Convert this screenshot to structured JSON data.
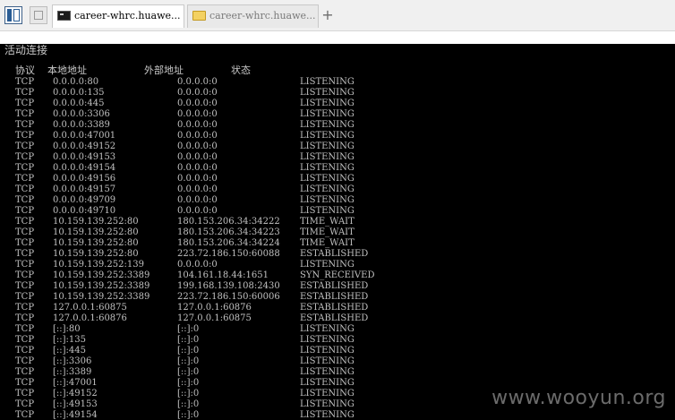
{
  "tabs": [
    {
      "label": "career-whrc.huawe...",
      "icon": "console-icon",
      "active": true
    },
    {
      "label": "career-whrc.huawe...",
      "icon": "folder-icon",
      "active": false
    }
  ],
  "toolbar": {
    "panel_icon": "panel-toggle-icon",
    "new_tab_icon": "blank-page-icon",
    "add_tab_label": "+"
  },
  "console": {
    "section_title": "活动连接",
    "headers": {
      "proto": "协议",
      "local": "本地地址",
      "foreign": "外部地址",
      "state": "状态"
    },
    "rows": [
      {
        "proto": "TCP",
        "local": "0.0.0.0:80",
        "foreign": "0.0.0.0:0",
        "state": "LISTENING"
      },
      {
        "proto": "TCP",
        "local": "0.0.0.0:135",
        "foreign": "0.0.0.0:0",
        "state": "LISTENING"
      },
      {
        "proto": "TCP",
        "local": "0.0.0.0:445",
        "foreign": "0.0.0.0:0",
        "state": "LISTENING"
      },
      {
        "proto": "TCP",
        "local": "0.0.0.0:3306",
        "foreign": "0.0.0.0:0",
        "state": "LISTENING"
      },
      {
        "proto": "TCP",
        "local": "0.0.0.0:3389",
        "foreign": "0.0.0.0:0",
        "state": "LISTENING"
      },
      {
        "proto": "TCP",
        "local": "0.0.0.0:47001",
        "foreign": "0.0.0.0:0",
        "state": "LISTENING"
      },
      {
        "proto": "TCP",
        "local": "0.0.0.0:49152",
        "foreign": "0.0.0.0:0",
        "state": "LISTENING"
      },
      {
        "proto": "TCP",
        "local": "0.0.0.0:49153",
        "foreign": "0.0.0.0:0",
        "state": "LISTENING"
      },
      {
        "proto": "TCP",
        "local": "0.0.0.0:49154",
        "foreign": "0.0.0.0:0",
        "state": "LISTENING"
      },
      {
        "proto": "TCP",
        "local": "0.0.0.0:49156",
        "foreign": "0.0.0.0:0",
        "state": "LISTENING"
      },
      {
        "proto": "TCP",
        "local": "0.0.0.0:49157",
        "foreign": "0.0.0.0:0",
        "state": "LISTENING"
      },
      {
        "proto": "TCP",
        "local": "0.0.0.0:49709",
        "foreign": "0.0.0.0:0",
        "state": "LISTENING"
      },
      {
        "proto": "TCP",
        "local": "0.0.0.0:49710",
        "foreign": "0.0.0.0:0",
        "state": "LISTENING"
      },
      {
        "proto": "TCP",
        "local": "10.159.139.252:80",
        "foreign": "180.153.206.34:34222",
        "state": "TIME_WAIT"
      },
      {
        "proto": "TCP",
        "local": "10.159.139.252:80",
        "foreign": "180.153.206.34:34223",
        "state": "TIME_WAIT"
      },
      {
        "proto": "TCP",
        "local": "10.159.139.252:80",
        "foreign": "180.153.206.34:34224",
        "state": "TIME_WAIT"
      },
      {
        "proto": "TCP",
        "local": "10.159.139.252:80",
        "foreign": "223.72.186.150:60088",
        "state": "ESTABLISHED"
      },
      {
        "proto": "TCP",
        "local": "10.159.139.252:139",
        "foreign": "0.0.0.0:0",
        "state": "LISTENING"
      },
      {
        "proto": "TCP",
        "local": "10.159.139.252:3389",
        "foreign": "104.161.18.44:1651",
        "state": "SYN_RECEIVED"
      },
      {
        "proto": "TCP",
        "local": "10.159.139.252:3389",
        "foreign": "199.168.139.108:2430",
        "state": "ESTABLISHED"
      },
      {
        "proto": "TCP",
        "local": "10.159.139.252:3389",
        "foreign": "223.72.186.150:60006",
        "state": "ESTABLISHED"
      },
      {
        "proto": "TCP",
        "local": "127.0.0.1:60875",
        "foreign": "127.0.0.1:60876",
        "state": "ESTABLISHED"
      },
      {
        "proto": "TCP",
        "local": "127.0.0.1:60876",
        "foreign": "127.0.0.1:60875",
        "state": "ESTABLISHED"
      },
      {
        "proto": "TCP",
        "local": "[::]:80",
        "foreign": "[::]:0",
        "state": "LISTENING"
      },
      {
        "proto": "TCP",
        "local": "[::]:135",
        "foreign": "[::]:0",
        "state": "LISTENING"
      },
      {
        "proto": "TCP",
        "local": "[::]:445",
        "foreign": "[::]:0",
        "state": "LISTENING"
      },
      {
        "proto": "TCP",
        "local": "[::]:3306",
        "foreign": "[::]:0",
        "state": "LISTENING"
      },
      {
        "proto": "TCP",
        "local": "[::]:3389",
        "foreign": "[::]:0",
        "state": "LISTENING"
      },
      {
        "proto": "TCP",
        "local": "[::]:47001",
        "foreign": "[::]:0",
        "state": "LISTENING"
      },
      {
        "proto": "TCP",
        "local": "[::]:49152",
        "foreign": "[::]:0",
        "state": "LISTENING"
      },
      {
        "proto": "TCP",
        "local": "[::]:49153",
        "foreign": "[::]:0",
        "state": "LISTENING"
      },
      {
        "proto": "TCP",
        "local": "[::]:49154",
        "foreign": "[::]:0",
        "state": "LISTENING"
      }
    ]
  },
  "watermark": "www.wooyun.org"
}
